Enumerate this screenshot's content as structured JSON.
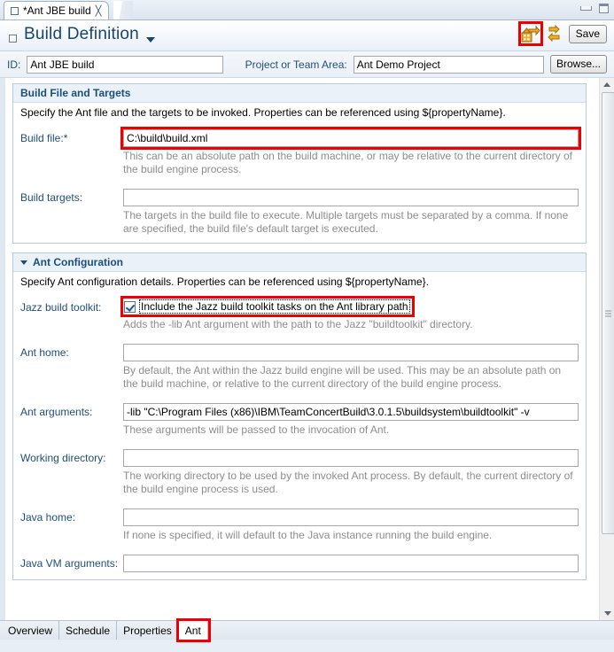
{
  "window": {
    "tab_title": "*Ant JBE build",
    "tab_icon": "editor-square-icon",
    "close_glyph": "╳",
    "minimize_label": "minimize-icon",
    "maximize_label": "maximize-icon"
  },
  "form_header": {
    "title": "Build Definition",
    "dropdown_icon": "chevron-down-icon",
    "request_build_icon": "request-build-icon",
    "refresh_icon": "refresh-icon",
    "save_label": "Save",
    "highlight_color": "#ee0000"
  },
  "id_row": {
    "id_label": "ID:",
    "id_value": "Ant JBE build",
    "project_label": "Project or Team Area:",
    "project_value": "Ant Demo Project",
    "browse_label": "Browse..."
  },
  "sections": [
    {
      "title": "Build File and Targets",
      "collapsible": false,
      "description": "Specify the Ant file and the targets to be invoked. Properties can be referenced using ${propertyName}.",
      "fields": [
        {
          "label": "Build file:*",
          "value": "C:\\build\\build.xml",
          "highlighted": true,
          "hint": "This can be an absolute path on the build machine, or may be relative to the current directory of the build engine process."
        },
        {
          "label": "Build targets:",
          "value": "",
          "highlighted": false,
          "hint": "The targets in the build file to execute. Multiple targets must be separated by a comma. If none are specified, the build file's default target is executed."
        }
      ]
    },
    {
      "title": "Ant Configuration",
      "collapsible": true,
      "description": "Specify Ant configuration details. Properties can be referenced using ${propertyName}.",
      "checkbox_field": {
        "label": "Jazz build toolkit:",
        "checkbox_label": "Include the Jazz build toolkit tasks on the Ant library path",
        "checked": true,
        "highlighted": true,
        "hint": "Adds the -lib Ant argument with the path to the Jazz \"buildtoolkit\" directory."
      },
      "fields": [
        {
          "label": "Ant home:",
          "value": "",
          "highlighted": false,
          "hint": "By default, the Ant within the Jazz build engine will be used. This may be an absolute path on the build machine, or relative to the current directory of the build engine process."
        },
        {
          "label": "Ant arguments:",
          "value": "-lib \"C:\\Program Files (x86)\\IBM\\TeamConcertBuild\\3.0.1.5\\buildsystem\\buildtoolkit\" -v",
          "highlighted": false,
          "hint": "These arguments will be passed to the invocation of Ant."
        },
        {
          "label": "Working directory:",
          "value": "",
          "highlighted": false,
          "hint": "The working directory to be used by the invoked Ant process. By default, the current directory of the build engine process is used."
        },
        {
          "label": "Java home:",
          "value": "",
          "highlighted": false,
          "hint": "If none is specified, it will default to the Java instance running the build engine."
        }
      ],
      "clipped_field": {
        "label": "Java VM arguments:",
        "value": ""
      }
    }
  ],
  "scrollbar": {
    "up_icon": "scroll-up-arrow-icon",
    "down_icon": "scroll-down-arrow-icon",
    "thumb": "scroll-thumb"
  },
  "bottom_tabs": [
    {
      "label": "Overview",
      "active": false,
      "highlighted": false
    },
    {
      "label": "Schedule",
      "active": false,
      "highlighted": false
    },
    {
      "label": "Properties",
      "active": false,
      "highlighted": false
    },
    {
      "label": "Ant",
      "active": true,
      "highlighted": true
    }
  ]
}
